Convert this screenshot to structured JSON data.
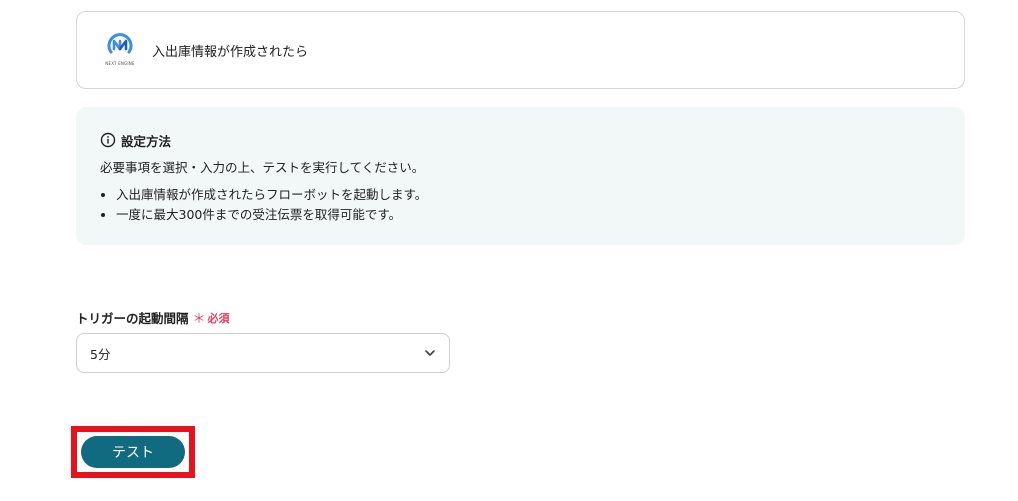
{
  "trigger": {
    "logo_caption": "NEXT ENGINE",
    "label": "入出庫情報が作成されたら"
  },
  "info": {
    "title": "設定方法",
    "description": "必要事項を選択・入力の上、テストを実行してください。",
    "items": [
      "入出庫情報が作成されたらフローボットを起動します。",
      "一度に最大300件までの受注伝票を取得可能です。"
    ]
  },
  "interval_field": {
    "label": "トリガーの起動間隔",
    "required_mark": "＊",
    "required_text": "必須",
    "selected_value": "5分"
  },
  "actions": {
    "test_label": "テスト"
  },
  "colors": {
    "accent": "#106b80",
    "required": "#e0435e",
    "highlight": "#e8121c",
    "info_bg": "#f1f8f7",
    "logo_blue": "#3a8ee6"
  },
  "icons": {
    "logo": "next-engine-logo",
    "info": "info-circle-icon",
    "select_arrow": "chevron-down-icon"
  }
}
